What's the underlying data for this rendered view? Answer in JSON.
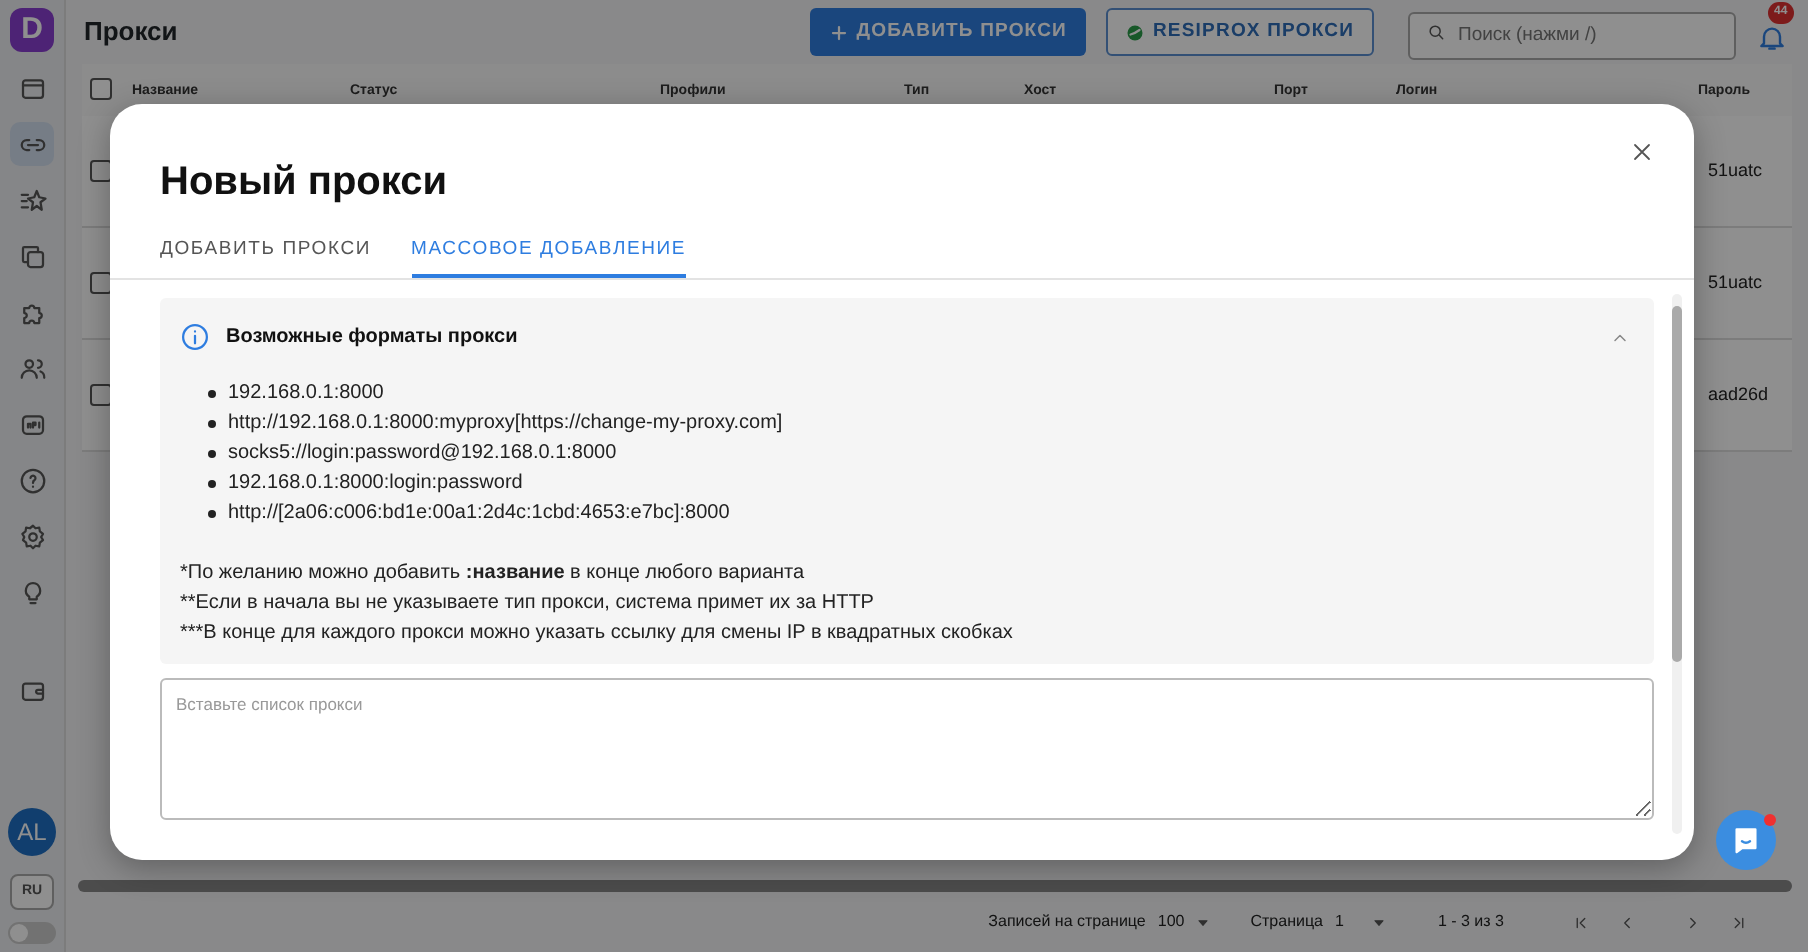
{
  "app": {
    "logo": "D",
    "title": "Прокси",
    "add_button": "ДОБАВИТЬ ПРОКСИ",
    "resiprox_button": "RESIPROX ПРОКСИ",
    "search": {
      "placeholder": "Поиск (нажми /)"
    },
    "notifications": {
      "count": "44"
    }
  },
  "sidebar": {
    "items": [
      {
        "kind": "browser",
        "selected": false
      },
      {
        "kind": "link",
        "selected": true
      },
      {
        "kind": "sparkle",
        "selected": false
      },
      {
        "kind": "copy",
        "selected": false
      },
      {
        "kind": "puzzle",
        "selected": false
      },
      {
        "kind": "users",
        "selected": false
      },
      {
        "kind": "api",
        "selected": false
      },
      {
        "kind": "help",
        "selected": false
      },
      {
        "kind": "settings",
        "selected": false
      },
      {
        "kind": "bulb",
        "selected": false
      },
      {
        "kind": "wallet",
        "selected": false
      }
    ],
    "avatar": "AL",
    "language": "RU",
    "dark_mode": {
      "on": false
    }
  },
  "table": {
    "all_checked": false,
    "columns": [
      "Название",
      "Статус",
      "Профили",
      "Тип",
      "Хост",
      "Порт",
      "Логин",
      "Пароль"
    ],
    "rows": [
      {
        "checked": false,
        "password": "51uatc"
      },
      {
        "checked": false,
        "password": "51uatc"
      },
      {
        "checked": false,
        "password": "aad26d"
      }
    ]
  },
  "pagination": {
    "rows_label": "Записей на странице",
    "rows_value": "100",
    "page_label": "Страница",
    "page_value": "1",
    "range": "1 - 3 из 3"
  },
  "modal": {
    "title": "Новый прокси",
    "tabs": [
      {
        "label": "ДОБАВИТЬ ПРОКСИ",
        "selected": false
      },
      {
        "label": "МАССОВОЕ ДОБАВЛЕНИЕ",
        "selected": true
      }
    ],
    "info": {
      "title": "Возможные форматы прокси",
      "expanded": true,
      "formats": [
        "192.168.0.1:8000",
        "http://192.168.0.1:8000:myproxy[https://change-my-proxy.com]",
        "socks5://login:password@192.168.0.1:8000",
        "192.168.0.1:8000:login:password",
        "http://[2a06:c006:bd1e:00a1:2d4c:1cbd:4653:e7bc]:8000"
      ],
      "notes": [
        "*По желанию можно добавить **:название** в конце любого варианта",
        "**Если в начала вы не указываете тип прокси, система примет их за HTTP",
        "***В конце для каждого прокси можно указать ссылку для смены IP в квадратных скобках"
      ]
    },
    "textarea": {
      "placeholder": "Вставьте список прокси"
    }
  },
  "chat": {
    "unread": true
  }
}
